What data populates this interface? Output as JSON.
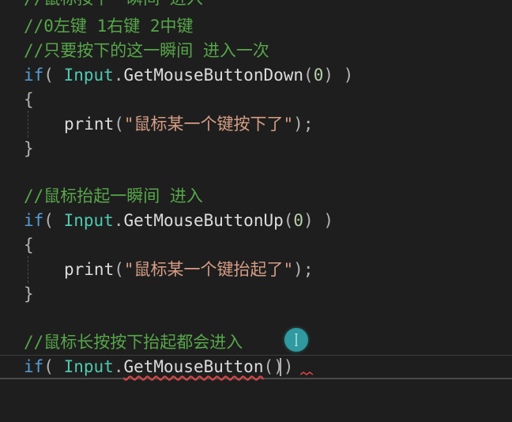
{
  "editor": {
    "lines": [
      {
        "comment": "//鼠标按下一瞬间 进入"
      },
      {
        "comment": "//0左键 1右键 2中键"
      },
      {
        "comment": "//只要按下的这一瞬间 进入一次"
      },
      {
        "kw": "if",
        "open": "( ",
        "cls": "Input",
        "dot": ".",
        "method": "GetMouseButtonDown",
        "lp": "(",
        "num": "0",
        "rp": ")",
        "close": " )"
      },
      {
        "brace": "{"
      },
      {
        "fn": "print",
        "lp": "(",
        "str": "\"鼠标某一个键按下了\"",
        "rp": ");"
      },
      {
        "brace": "}"
      },
      {
        "comment": "//鼠标抬起一瞬间 进入"
      },
      {
        "kw": "if",
        "open": "( ",
        "cls": "Input",
        "dot": ".",
        "method": "GetMouseButtonUp",
        "lp": "(",
        "num": "0",
        "rp": ")",
        "close": " )"
      },
      {
        "brace": "{"
      },
      {
        "fn": "print",
        "lp": "(",
        "str": "\"鼠标某一个键抬起了\"",
        "rp": ");"
      },
      {
        "brace": "}"
      },
      {
        "comment": "//鼠标长按按下抬起都会进入"
      },
      {
        "kw": "if",
        "open": "( ",
        "cls": "Input",
        "dot": ".",
        "method": "GetMouseButton",
        "parens": "())"
      }
    ]
  },
  "colors": {
    "background": "#1e1e1e",
    "comment": "#57a64a",
    "keyword": "#569cd6",
    "class": "#4ec9b0",
    "string": "#d69d85",
    "error_squiggle": "#e04545",
    "cursor_marker": "#2f9aa0"
  },
  "icons": {
    "cursor": "text-cursor-ibeam-icon"
  }
}
